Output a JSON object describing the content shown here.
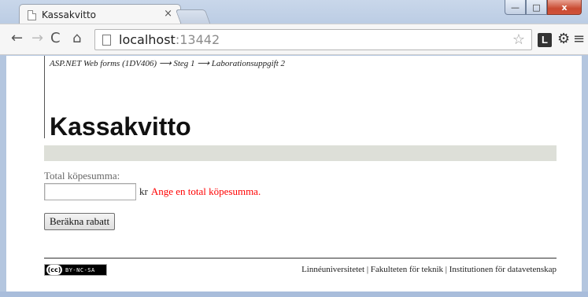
{
  "browser": {
    "tab_title": "Kassakvitto",
    "tab_close": "×",
    "url_host": "localhost",
    "url_port": ":13442",
    "window_buttons": {
      "minimize": "—",
      "maximize": "□",
      "close": "x"
    },
    "icons": {
      "back": "←",
      "forward": "→",
      "reload": "C",
      "home": "⌂",
      "star": "☆",
      "extension": "L",
      "settings": "⚙",
      "menu": "≡"
    }
  },
  "page": {
    "breadcrumb": "ASP.NET Web forms (1DV406) ⟶ Steg 1 ⟶ Laborationsuppgift 2",
    "heading": "Kassakvitto",
    "form": {
      "label": "Total köpesumma:",
      "input_value": "",
      "unit": "kr",
      "error": "Ange en total köpesumma.",
      "submit_label": "Beräkna rabatt"
    },
    "footer": {
      "license_badge_left": "(cc)",
      "license_badge_right": "BY-NC-SA",
      "links_text": "Linnéuniversitetet | Fakulteten för teknik | Institutionen för datavetenskap"
    }
  },
  "colors": {
    "error": "#ff0000",
    "bar": "#dddfd8",
    "window_frame": "#b4c6df"
  }
}
